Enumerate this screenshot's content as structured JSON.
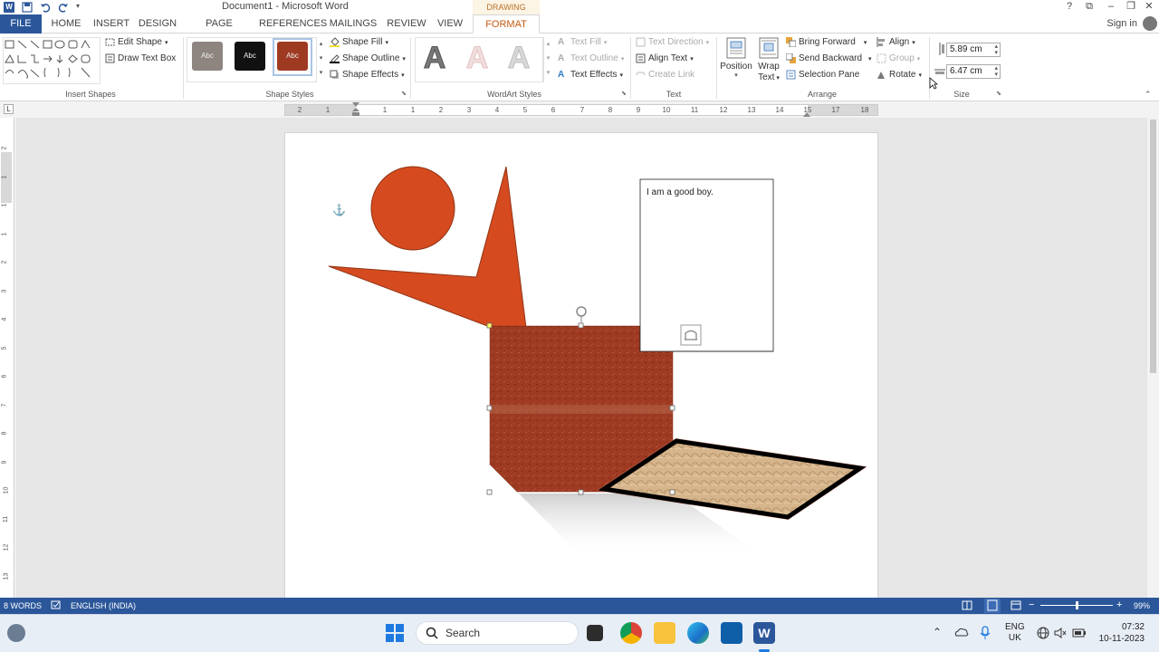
{
  "window": {
    "title": "Document1 - Microsoft Word",
    "contextual_tab_group": "DRAWING TOOLS",
    "controls": [
      "?",
      "⧉",
      "–",
      "❐",
      "✕"
    ]
  },
  "tabs": {
    "file": "FILE",
    "items": [
      "HOME",
      "INSERT",
      "DESIGN",
      "PAGE LAYOUT",
      "REFERENCES",
      "MAILINGS",
      "REVIEW",
      "VIEW"
    ],
    "active": "FORMAT",
    "sign_in": "Sign in"
  },
  "ribbon": {
    "insert_shapes": {
      "label": "Insert Shapes",
      "edit_shape": "Edit Shape",
      "draw_text_box": "Draw Text Box"
    },
    "shape_styles": {
      "label": "Shape Styles",
      "swatch_text": "Abc",
      "shape_fill": "Shape Fill",
      "shape_outline": "Shape Outline",
      "shape_effects": "Shape Effects"
    },
    "wordart_styles": {
      "label": "WordArt Styles",
      "letter": "A",
      "text_fill": "Text Fill",
      "text_outline": "Text Outline",
      "text_effects": "Text Effects"
    },
    "text": {
      "label": "Text",
      "text_direction": "Text Direction",
      "align_text": "Align Text",
      "create_link": "Create Link"
    },
    "arrange": {
      "label": "Arrange",
      "position": "Position",
      "wrap_text_1": "Wrap",
      "wrap_text_2": "Text",
      "bring_forward": "Bring Forward",
      "send_backward": "Send Backward",
      "selection_pane": "Selection Pane",
      "align": "Align",
      "group": "Group",
      "rotate": "Rotate"
    },
    "size": {
      "label": "Size",
      "height": "5.89 cm",
      "width": "6.47 cm"
    }
  },
  "ruler": {
    "horizontal": [
      "2",
      "1",
      "1",
      "1",
      "2",
      "3",
      "4",
      "5",
      "6",
      "7",
      "8",
      "9",
      "10",
      "11",
      "12",
      "13",
      "14",
      "15",
      "17",
      "18"
    ],
    "vertical": [
      "2",
      "1",
      "1",
      "1",
      "2",
      "3",
      "4",
      "5",
      "6",
      "7",
      "8",
      "9",
      "10",
      "11",
      "12",
      "13"
    ]
  },
  "document": {
    "textbox_text": "I am a good boy.",
    "colors": {
      "circle": "#d64a1f",
      "star": "#d64a1f",
      "selected_rect": "#9e3a22",
      "parchment": "#d6b58c"
    }
  },
  "status": {
    "words": "8 WORDS",
    "language": "ENGLISH (INDIA)",
    "zoom": "99%"
  },
  "taskbar": {
    "search": "Search",
    "lang_1": "ENG",
    "lang_2": "UK",
    "time": "07:32",
    "date": "10-11-2023"
  }
}
